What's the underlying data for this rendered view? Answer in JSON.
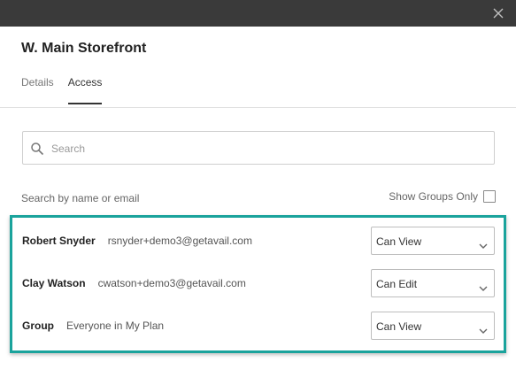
{
  "dialog": {
    "title": "W. Main Storefront",
    "close_icon": "close-icon"
  },
  "tabs": [
    {
      "label": "Details",
      "active": false
    },
    {
      "label": "Access",
      "active": true
    }
  ],
  "search": {
    "placeholder": "Search",
    "value": "",
    "icon": "search-icon"
  },
  "filter": {
    "hint": "Search by name or email",
    "show_groups_label": "Show Groups Only",
    "show_groups_checked": false
  },
  "access_list": [
    {
      "name": "Robert Snyder",
      "detail": "rsnyder+demo3@getavail.com",
      "permission": "Can View"
    },
    {
      "name": "Clay Watson",
      "detail": "cwatson+demo3@getavail.com",
      "permission": "Can Edit"
    },
    {
      "name": "Group",
      "detail": "Everyone in My Plan",
      "permission": "Can View"
    }
  ],
  "colors": {
    "topbar": "#3a3a3a",
    "highlight_border": "#1aa39c"
  }
}
